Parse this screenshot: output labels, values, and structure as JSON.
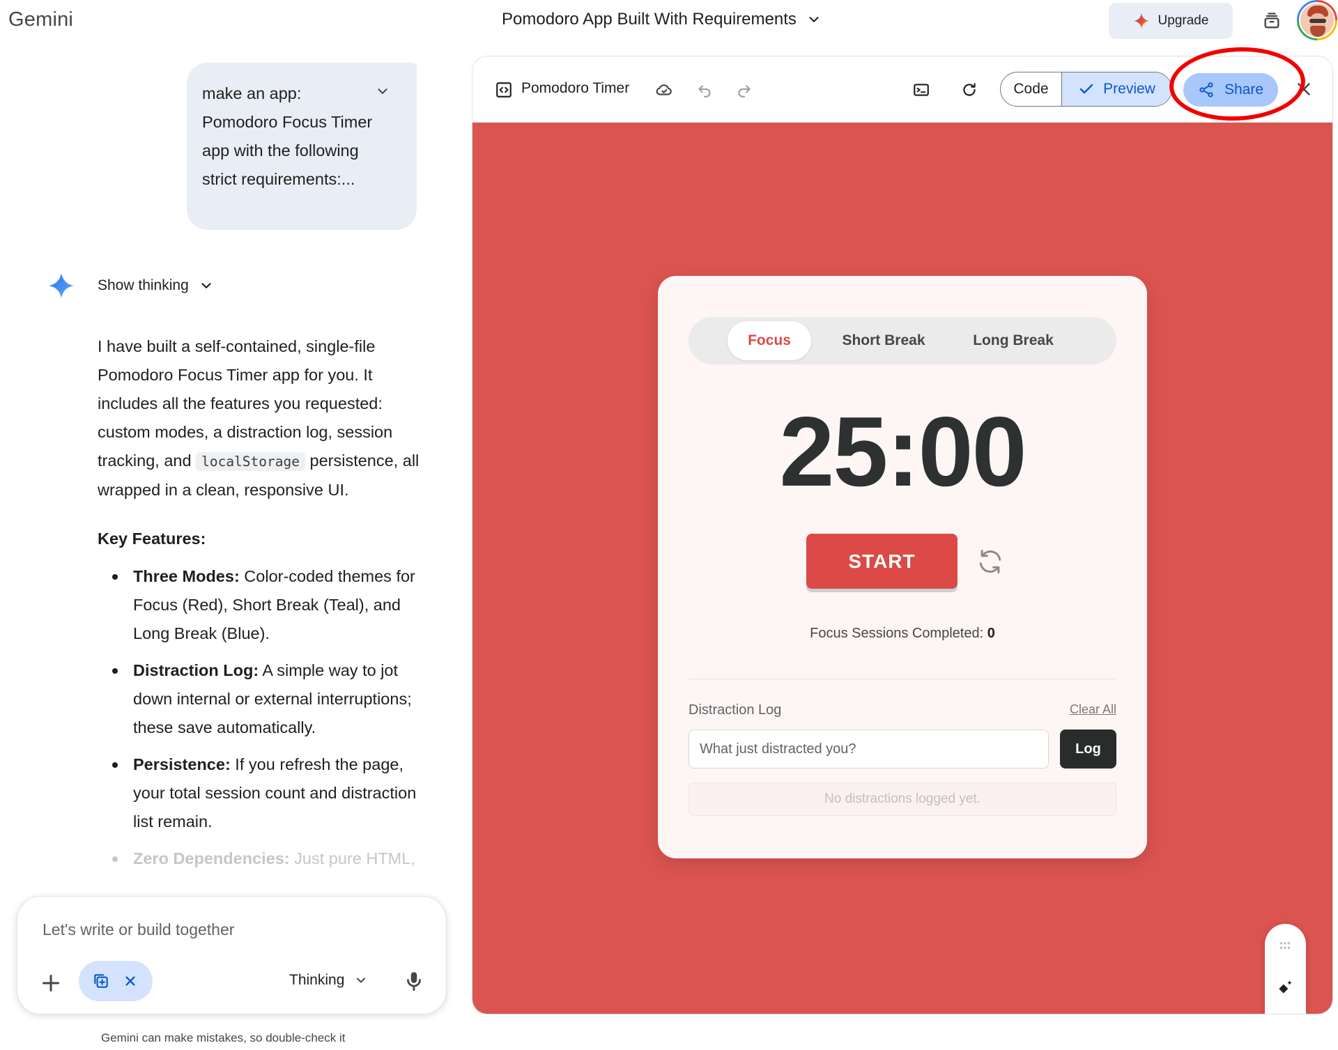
{
  "header": {
    "brand": "Gemini",
    "conversation_title": "Pomodoro App Built With Requirements",
    "upgrade_label": "Upgrade"
  },
  "chat": {
    "user_message": "make an app: Pomodoro Focus Timer app with the following strict requirements:...",
    "show_thinking_label": "Show thinking",
    "response_part1": "I have built a self-contained, single-file Pomodoro Focus Timer app for you. It includes all the features you requested: custom modes, a distraction log, session tracking, and ",
    "response_code": "localStorage",
    "response_part2": " persistence, all wrapped in a clean, responsive UI.",
    "features_heading": "Key Features:",
    "features": [
      {
        "title": "Three Modes:",
        "text": " Color-coded themes for Focus (Red), Short Break (Teal), and Long Break (Blue)."
      },
      {
        "title": "Distraction Log:",
        "text": " A simple way to jot down internal or external interruptions; these save automatically."
      },
      {
        "title": "Persistence:",
        "text": " If you refresh the page, your total session count and distraction list remain."
      },
      {
        "title": "Zero Dependencies:",
        "text": " Just pure HTML,"
      }
    ]
  },
  "input": {
    "placeholder": "Let's write or build together",
    "mode_label": "Thinking",
    "disclaimer": "Gemini can make mistakes, so double-check it"
  },
  "canvas": {
    "title": "Pomodoro Timer",
    "code_label": "Code",
    "preview_label": "Preview",
    "share_label": "Share",
    "active_view": "preview"
  },
  "app": {
    "modes": [
      "Focus",
      "Short Break",
      "Long Break"
    ],
    "active_mode": "Focus",
    "timer": "25:00",
    "start_label": "START",
    "sessions_label": "Focus Sessions Completed:",
    "sessions_count": "0",
    "log_title": "Distraction Log",
    "clear_all_label": "Clear All",
    "log_input_placeholder": "What just distracted you?",
    "log_button_label": "Log",
    "empty_log_text": "No distractions logged yet."
  },
  "colors": {
    "focus_theme": "#db5450",
    "accent_red": "#db4a46",
    "preview_active": "#d3e3fd",
    "share_button": "#a8c7fa",
    "annotation": "#f20000"
  },
  "icons": {
    "spark": "gemini-spark-icon",
    "reset": "refresh-icon",
    "share": "share-icon"
  }
}
